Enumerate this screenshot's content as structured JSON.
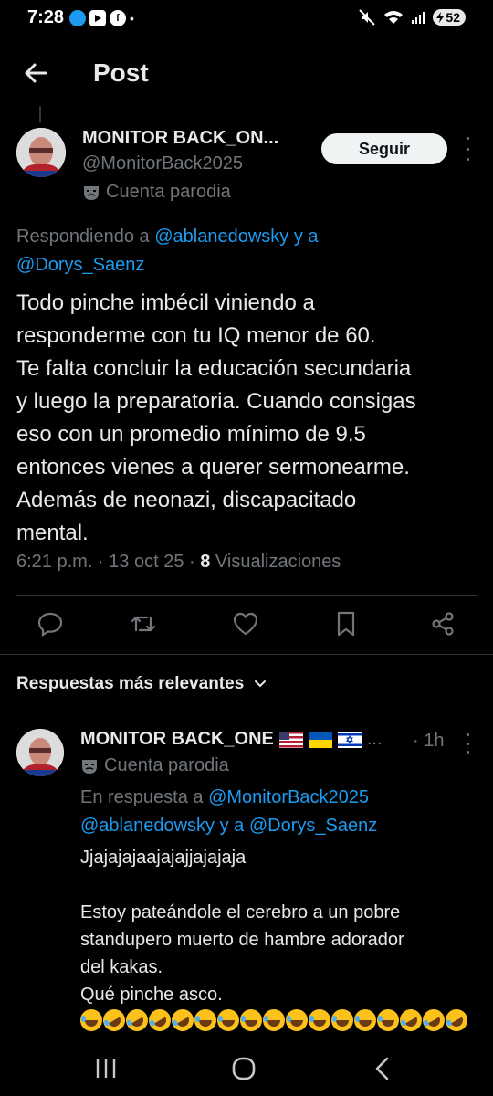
{
  "status_bar": {
    "time": "7:28",
    "battery": "52"
  },
  "header": {
    "title": "Post"
  },
  "post": {
    "author_name": "MONITOR BACK_ON...",
    "author_handle": "@MonitorBack2025",
    "account_label": "Cuenta parodia",
    "follow_label": "Seguir",
    "replying_prefix": "Respondiendo a",
    "replying_user1": "@ablanedowsky",
    "replying_and": "y a",
    "replying_user2": "@Dorys_Saenz",
    "body": "Todo pinche imbécil viniendo a\nresponderme con tu IQ menor de 60.\nTe falta concluir la educación secundaria\ny luego la preparatoria. Cuando consigas\neso con un promedio mínimo de 9.5\nentonces vienes a querer sermonearme.\nAdemás de neonazi, discapacitado\nmental.",
    "timestamp": "6:21 p.m. · 13 oct 25 ·",
    "views_count": "8",
    "views_label": "Visualizaciones"
  },
  "replies_section": {
    "title": "Respuestas más relevantes"
  },
  "reply": {
    "author_name": "MONITOR BACK_ONE",
    "flags_ellipsis": "...",
    "time": "· 1h",
    "account_label": "Cuenta parodia",
    "in_reply_prefix": "En respuesta a",
    "in_reply_user1": "@MonitorBack2025",
    "in_reply_user2": "@ablanedowsky",
    "in_reply_and": "y a",
    "in_reply_user3": "@Dorys_Saenz",
    "line1": "Jjajajajaajajajjajajaja",
    "paragraph": "Estoy pateándole el cerebro a un pobre\nstandupero muerto de hambre adorador\ndel kakas.\nQué pinche asco."
  },
  "colors": {
    "background": "#000000",
    "text": "#e7e9ea",
    "muted": "#71767b",
    "link": "#1d9bf0",
    "divider": "#2f3336"
  }
}
